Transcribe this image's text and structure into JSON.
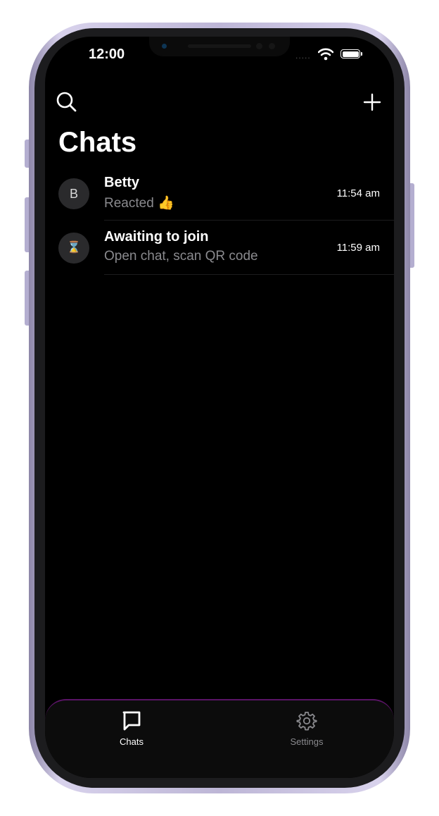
{
  "status_bar": {
    "time": "12:00",
    "signal": "....."
  },
  "header": {
    "title": "Chats"
  },
  "chats": [
    {
      "avatar": "B",
      "name": "Betty",
      "preview": "Reacted 👍",
      "time": "11:54 am"
    },
    {
      "avatar": "⌛",
      "name": "Awaiting to join",
      "preview": "Open chat, scan QR code",
      "time": "11:59 am"
    }
  ],
  "tabs": [
    {
      "label": "Chats",
      "icon": "chat-bubble-icon",
      "active": true
    },
    {
      "label": "Settings",
      "icon": "gear-icon",
      "active": false
    }
  ],
  "colors": {
    "background": "#000000",
    "accent": "#5a1466",
    "frame": "#bdb6d6"
  }
}
